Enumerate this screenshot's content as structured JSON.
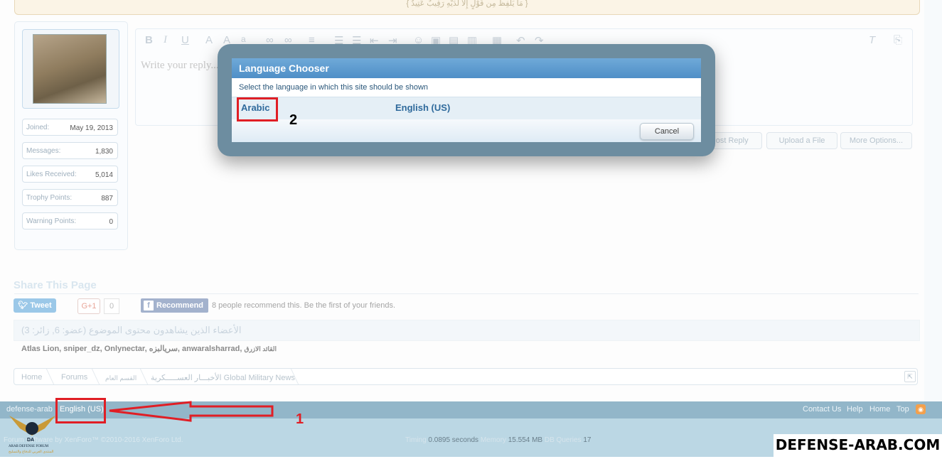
{
  "quote": "{ مَا يَلْفِظُ مِن قَوْلٍ إِلَّا لَدَيْهِ رَقِيبٌ عَتِيدٌ }",
  "user_stats": [
    {
      "label": "Joined:",
      "value": "May 19, 2013"
    },
    {
      "label": "Messages:",
      "value": "1,830"
    },
    {
      "label": "Likes Received:",
      "value": "5,014"
    },
    {
      "label": "Trophy Points:",
      "value": "887"
    },
    {
      "label": "Warning Points:",
      "value": "0"
    }
  ],
  "editor": {
    "placeholder": "Write your reply...",
    "toolbar_icons": [
      "bold-icon",
      "italic-icon",
      "underline-icon",
      "font-color-icon",
      "font-size-icon",
      "font-family-icon",
      "link-icon",
      "unlink-icon",
      "align-icon",
      "bullet-list-icon",
      "numbered-list-icon",
      "outdent-icon",
      "indent-icon",
      "smilie-icon",
      "image-icon",
      "media-icon",
      "draft-save-icon",
      "undo-icon",
      "redo-icon",
      "remove-format-icon",
      "toggle-bbcode-icon"
    ],
    "toolbar_glyphs": {
      "bold": "B",
      "italic": "I",
      "underline": "U"
    },
    "post_reply": "Post Reply",
    "upload": "Upload a File",
    "more": "More Options..."
  },
  "share": {
    "title": "Share This Page",
    "tweet": "Tweet",
    "gplus": "G+1",
    "gplus_count": "0",
    "fb_recommend": "Recommend",
    "fb_text": "8 people recommend this. Be the first of your friends."
  },
  "viewers": {
    "title": "الأعضاء الذين يشاهدون محتوى الموضوع (عضو: 6, زائر: 3)",
    "names_latin": "Atlas Lion, sniper_dz, Onlynectar, ",
    "names_ar1": "سريالبزه",
    "names_mid": ", anwaralsharrad, ",
    "names_ar2": "القائد الازرق"
  },
  "breadcrumb": {
    "home": "Home",
    "forums": "Forums",
    "section": "القسم العام",
    "forum": "الأخبـــار العســـــكرية Global Military News"
  },
  "modal": {
    "title": "Language Chooser",
    "description": "Select the language in which this site should be shown",
    "lang_arabic": "Arabic",
    "lang_english": "English (US)",
    "cancel": "Cancel"
  },
  "footer": {
    "site": "defense-arab",
    "language": "English (US)",
    "links": [
      "Contact Us",
      "Help",
      "Home",
      "Top"
    ],
    "copyright": "Forum software by XenForo™ ©2010-2016 XenForo Ltd.",
    "timing_label1": "Timing",
    "timing_value": "0.0895 seconds",
    "memory_label": "Memory",
    "memory_value": "15.554 MB",
    "queries_label": "DB Queries",
    "queries_value": "17"
  },
  "logo": {
    "text1": "DA",
    "text2": "ARAB DEFENSE FORUM",
    "text3": "المنتدى العربي للدفاع والتسليح"
  },
  "watermark": "DEFENSE-ARAB.COM",
  "annotations": {
    "step1": "1",
    "step2": "2"
  },
  "colors": {
    "footer_bar": "#92b6c9",
    "modal_header": "#5b9bd0",
    "annotation_red": "#e01e25",
    "link_blue": "#2f6a9c"
  }
}
